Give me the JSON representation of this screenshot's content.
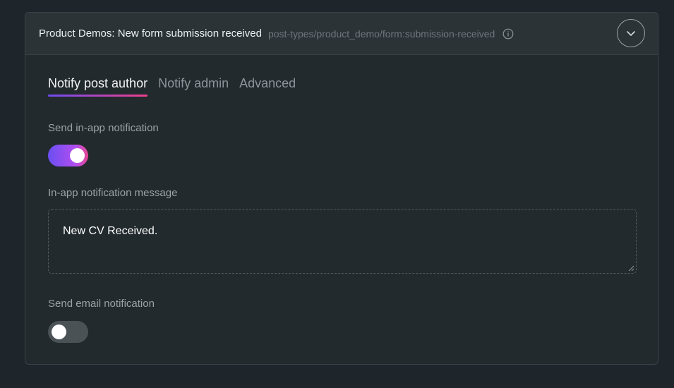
{
  "header": {
    "title": "Product Demos: New form submission received",
    "path": "post-types/product_demo/form:submission-received",
    "info_icon": "info-icon",
    "collapse_icon": "chevron-down-icon"
  },
  "tabs": [
    {
      "label": "Notify post author",
      "active": true
    },
    {
      "label": "Notify admin",
      "active": false
    },
    {
      "label": "Advanced",
      "active": false
    }
  ],
  "in_app": {
    "label": "Send in-app notification",
    "enabled": true
  },
  "message": {
    "label": "In-app notification message",
    "value": "New CV Received."
  },
  "email": {
    "label": "Send email notification",
    "enabled": false
  },
  "colors": {
    "accent_start": "#6a4ff2",
    "accent_end": "#e8458f",
    "background": "#1f262b",
    "panel": "#222a2e"
  }
}
